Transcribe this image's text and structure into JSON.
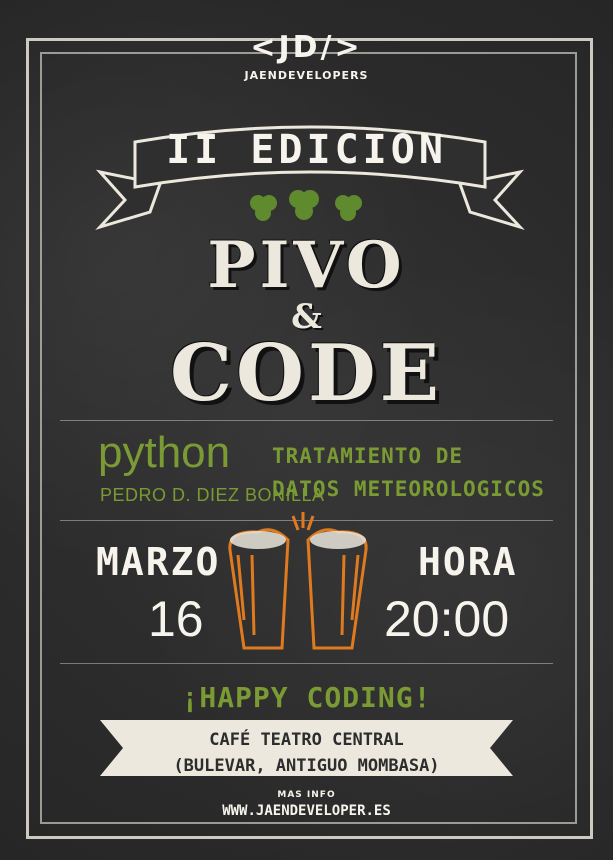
{
  "logo": {
    "mark": "<JD/>",
    "name": "JAENDEVELOPERS"
  },
  "edition": "II EDICION",
  "title": {
    "line1": "PIVO",
    "amp": "&",
    "line2": "CODE"
  },
  "talk": {
    "language": "python",
    "speaker": "PEDRO D. DIEZ BONILLA",
    "topic_line1": "TRATAMIENTO DE",
    "topic_line2": "DATOS METEOROLOGICOS"
  },
  "date": {
    "month": "MARZO",
    "day": "16"
  },
  "time": {
    "label": "HORA",
    "value": "20:00"
  },
  "slogan": "¡HAPPY CODING!",
  "venue": {
    "name": "CAFÉ TEATRO CENTRAL",
    "address": "(BULEVAR, ANTIGUO MOMBASA)"
  },
  "info": {
    "label": "MAS INFO",
    "url": "WWW.JAENDEVELOPER.ES"
  },
  "colors": {
    "accent": "#7a9a33",
    "beer": "#e07a1f",
    "chalk": "#f1efe6",
    "board": "#2f2f2f"
  },
  "icons": [
    "clover-icon",
    "beer-glasses-icon"
  ]
}
